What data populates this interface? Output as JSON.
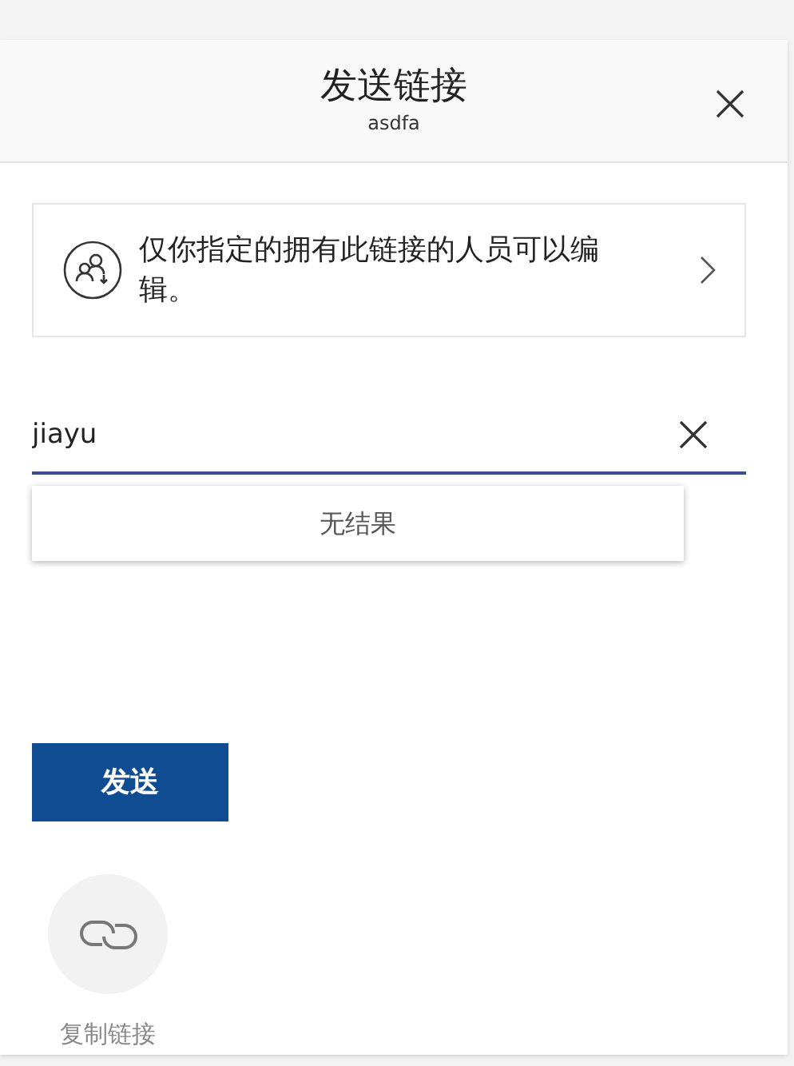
{
  "header": {
    "title": "发送链接",
    "subtitle": "asdfa"
  },
  "permission": {
    "text": "仅你指定的拥有此链接的人员可以编辑。"
  },
  "recipient_field": {
    "value": "jiayu"
  },
  "suggestions": {
    "message": "无结果"
  },
  "send_button": {
    "label": "发送"
  },
  "actions": [
    {
      "kind": "copy-link",
      "label": "复制链接"
    }
  ]
}
